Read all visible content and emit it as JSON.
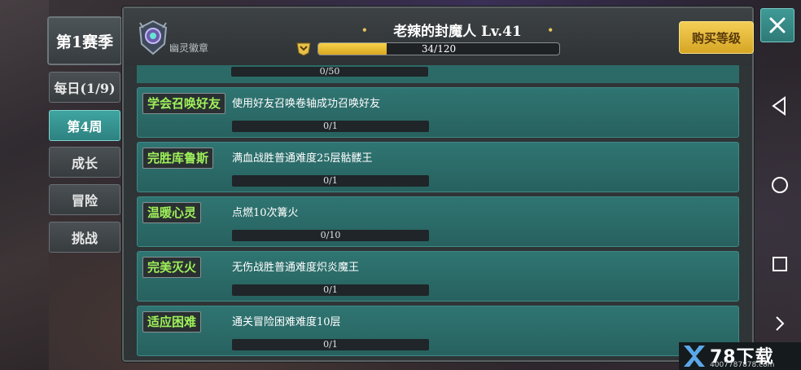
{
  "sidebar": {
    "season_label": "第1赛季",
    "tabs": [
      {
        "label": "每日(1/9)"
      },
      {
        "label": "第4周"
      },
      {
        "label": "成长"
      },
      {
        "label": "冒险"
      },
      {
        "label": "挑战"
      }
    ]
  },
  "header": {
    "badge_label": "幽灵徽章",
    "title": "老辣的封魔人 Lv.41",
    "progress_text": "34/120",
    "progress_value": 34,
    "progress_max": 120,
    "buy_label": "购买等级"
  },
  "quests": {
    "partial_progress": "0/50",
    "items": [
      {
        "name": "学会召唤好友",
        "desc": "使用好友召唤卷轴成功召唤好友",
        "progress": "0/1"
      },
      {
        "name": "完胜库鲁斯",
        "desc": "满血战胜普通难度25层骷髅王",
        "progress": "0/1"
      },
      {
        "name": "温暖心灵",
        "desc": "点燃10次篝火",
        "progress": "0/10"
      },
      {
        "name": "完美灭火",
        "desc": "无伤战胜普通难度炽炎魔王",
        "progress": "0/1"
      },
      {
        "name": "适应困难",
        "desc": "通关冒险困难难度10层",
        "progress": "0/1"
      }
    ]
  },
  "watermark": {
    "text": "78下载",
    "sub": "4007787878.com"
  },
  "colors": {
    "accent": "#2f7572",
    "gold": "#f4cf55",
    "quest_name": "#9ef15a"
  },
  "icons": [
    "ghost-badge-icon",
    "level-icon",
    "close-icon",
    "back-icon",
    "home-icon",
    "recent-icon",
    "chevron-right-icon"
  ]
}
